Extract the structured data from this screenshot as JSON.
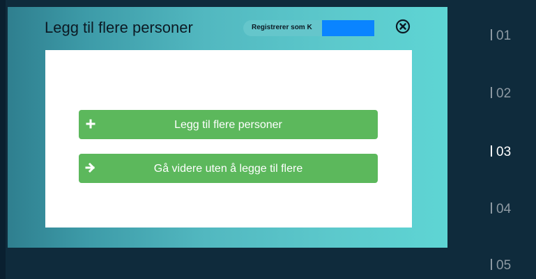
{
  "modal": {
    "title": "Legg til flere personer",
    "registering_label": "Registrerer som K",
    "close_icon": "close-circle-icon"
  },
  "actions": [
    {
      "label": "Legg til flere personer",
      "icon": "plus-icon"
    },
    {
      "label": "Gå videre uten å legge til flere",
      "icon": "arrow-right-icon"
    }
  ],
  "steps": [
    {
      "label": "01",
      "active": false
    },
    {
      "label": "02",
      "active": false
    },
    {
      "label": "03",
      "active": true
    },
    {
      "label": "04",
      "active": false
    },
    {
      "label": "05",
      "active": false
    }
  ],
  "colors": {
    "background": "#0f2b3c",
    "button": "#5cb85c",
    "redaction": "#0a84ff",
    "step_inactive": "#8e9aa3",
    "step_active": "#ffffff"
  }
}
